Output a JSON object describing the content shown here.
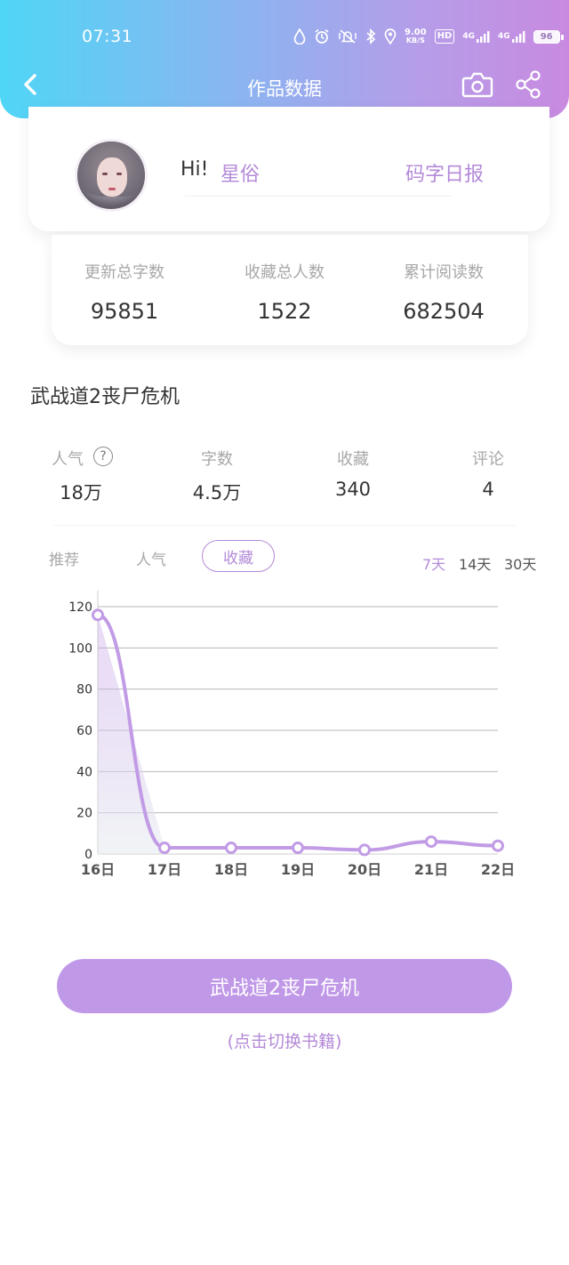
{
  "status_bar": {
    "time": "07:31",
    "net_speed_value": "9.00",
    "net_speed_unit": "KB/S",
    "hd_label": "HD",
    "signal1_label": "4G",
    "signal2_label": "4G",
    "battery": "96"
  },
  "nav": {
    "title": "作品数据",
    "back_icon": "chevron-left",
    "camera_icon": "camera",
    "share_icon": "share"
  },
  "profile": {
    "greeting": "Hi!",
    "username": "星俗",
    "daily_report_link": "码字日报"
  },
  "totals": [
    {
      "label": "更新总字数",
      "value": "95851"
    },
    {
      "label": "收藏总人数",
      "value": "1522"
    },
    {
      "label": "累计阅读数",
      "value": "682504"
    }
  ],
  "book": {
    "title": "武战道2丧尸危机"
  },
  "stats": [
    {
      "label": "人气",
      "value": "18万"
    },
    {
      "label": "字数",
      "value": "4.5万"
    },
    {
      "label": "收藏",
      "value": "340"
    },
    {
      "label": "评论",
      "value": "4"
    }
  ],
  "help_icon_glyph": "?",
  "chart_tabs": {
    "items": [
      "推荐",
      "人气",
      "收藏"
    ],
    "selected": "收藏"
  },
  "ranges": {
    "items": [
      "7天",
      "14天",
      "30天"
    ],
    "selected": "7天"
  },
  "colors": {
    "accent": "#b48ad8",
    "button": "#c098e8",
    "line": "#c29be6"
  },
  "chart_data": {
    "type": "line",
    "categories": [
      "16日",
      "17日",
      "18日",
      "19日",
      "20日",
      "21日",
      "22日"
    ],
    "values": [
      116,
      3,
      3,
      3,
      2,
      6,
      4
    ],
    "ylim": [
      0,
      120
    ],
    "yticks": [
      0,
      20,
      40,
      60,
      80,
      100,
      120
    ],
    "grid": true,
    "title": "",
    "xlabel": "",
    "ylabel": ""
  },
  "switch_book": {
    "button_label": "武战道2丧尸危机",
    "hint": "(点击切换书籍)"
  }
}
